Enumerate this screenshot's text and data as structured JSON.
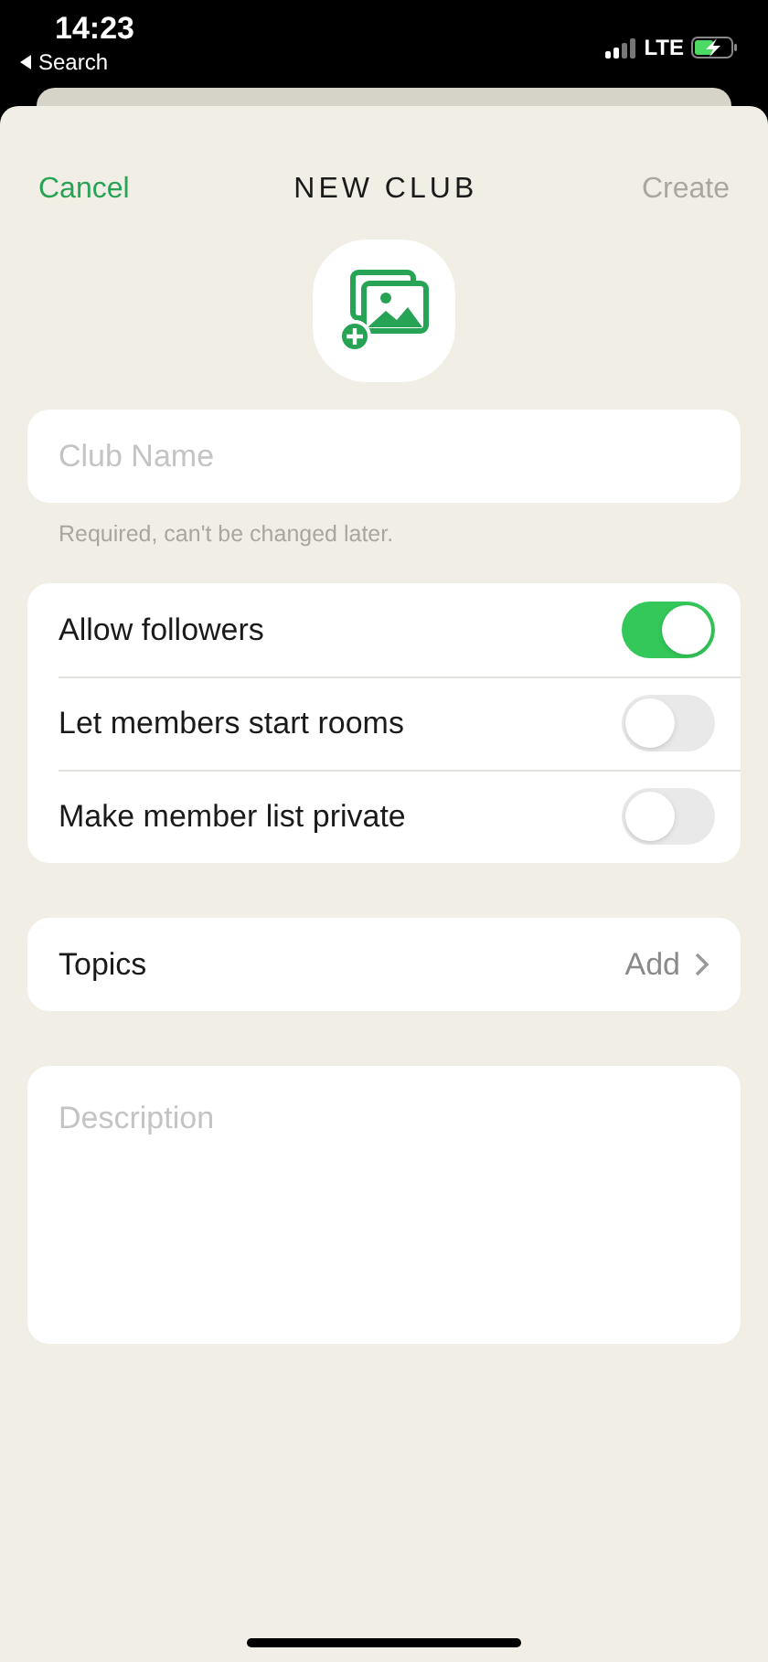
{
  "status_bar": {
    "time": "14:23",
    "back_label": "Search",
    "network": "LTE"
  },
  "header": {
    "cancel": "Cancel",
    "title": "NEW CLUB",
    "create": {
      "label": "Create",
      "disabled": true
    }
  },
  "club_name": {
    "placeholder": "Club Name",
    "hint": "Required, can't be changed later."
  },
  "settings": [
    {
      "label": "Allow followers",
      "on": true
    },
    {
      "label": "Let members start rooms",
      "on": false
    },
    {
      "label": "Make member list private",
      "on": false
    }
  ],
  "topics": {
    "label": "Topics",
    "action": "Add"
  },
  "description": {
    "placeholder": "Description"
  }
}
